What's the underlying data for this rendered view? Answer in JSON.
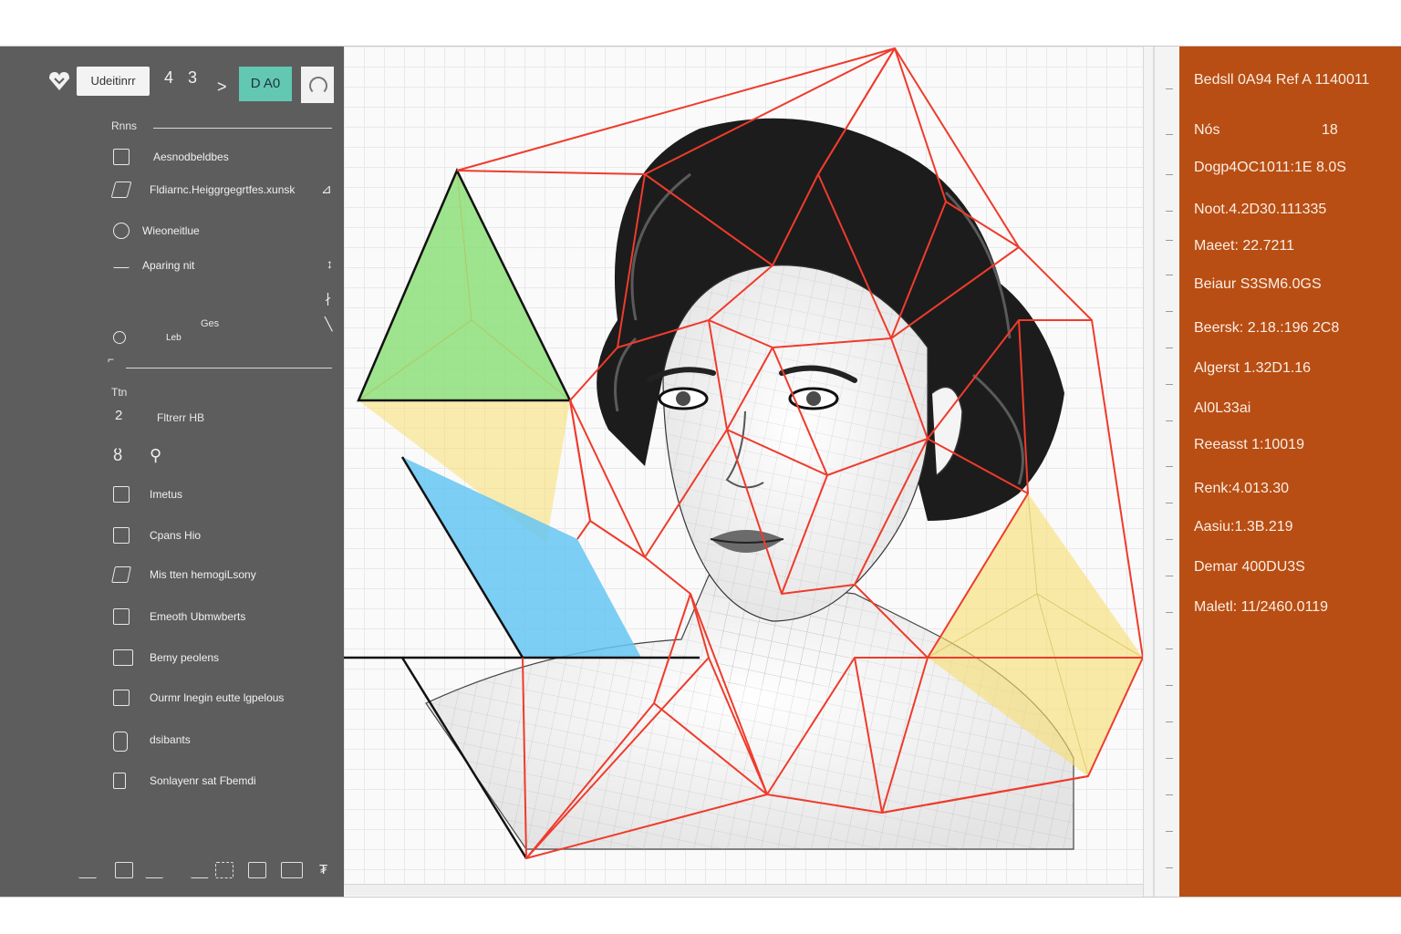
{
  "toolbar": {
    "search_label": "Udeitinrr",
    "glyph_a": "4",
    "glyph_b": "3",
    "chevron": ">",
    "teal_button_label": "D A0"
  },
  "sidebar": {
    "section1_label": "Rnns",
    "items_top": [
      {
        "label": "Aesnodbeldbes",
        "icon": "image-icon"
      },
      {
        "label": "Fldiarnc.Heiggrgegrtfes.xunsk",
        "icon": "brush-icon"
      },
      {
        "label": "Wieoneitlue",
        "icon": "layers-icon"
      },
      {
        "label": "Aparing nit",
        "icon": "wave-icon"
      },
      {
        "label": "Ges",
        "icon": "none"
      },
      {
        "label": "Leb",
        "icon": "pin-icon"
      }
    ],
    "section2_label": "Ttn",
    "section2_item": "Fltrerr HB",
    "section2_num": "2",
    "items_bottom": [
      {
        "label": "Imetus",
        "icon": "image-icon"
      },
      {
        "label": "Cpans Hio",
        "icon": "square-icon"
      },
      {
        "label": "Mis tten hemogiLsony",
        "icon": "pen-icon"
      },
      {
        "label": "Emeoth Ubmwberts",
        "icon": "frame-icon"
      },
      {
        "label": "Bemy peolens",
        "icon": "stack-icon"
      },
      {
        "label": "Ourmr lnegin eutte lgpelous",
        "icon": "grid-icon"
      },
      {
        "label": "dsibants",
        "icon": "phone-icon"
      },
      {
        "label": "Sonlayenr sat Fbemdi",
        "icon": "bracket-icon"
      }
    ]
  },
  "properties": [
    {
      "label": "Bedsll 0A94 Ref A 1140011",
      "value": ""
    },
    {
      "label": "Nós",
      "value": "18"
    },
    {
      "label": "Dogp4OC1011:1E 8.0S",
      "value": ""
    },
    {
      "label": "Noot.4.2D30.111335",
      "value": ""
    },
    {
      "label": "Maeet: 22.7211",
      "value": ""
    },
    {
      "label": "Beiaur S3SM6.0GS",
      "value": ""
    },
    {
      "label": "Beersk: 2.18.:196 2C8",
      "value": ""
    },
    {
      "label": "Algerst 1.32D1.16",
      "value": ""
    },
    {
      "label": "Al0L33ai",
      "value": ""
    },
    {
      "label": "Reeasst 1:10019",
      "value": ""
    },
    {
      "label": "Renk:4.013.30",
      "value": ""
    },
    {
      "label": "Aasiu:1.3B.219",
      "value": ""
    },
    {
      "label": "Demar 400DU3S",
      "value": ""
    },
    {
      "label": "Maletl: 11/2460.0119",
      "value": ""
    }
  ],
  "colors": {
    "sidebar_bg": "#5d5d5d",
    "panel_bg": "#b84e14",
    "accent_teal": "#62c8b2",
    "mesh_red": "#ef3b2c",
    "poly_green": "#8fe07a",
    "poly_yellow": "#f7de6e",
    "poly_blue": "#66c6f3"
  }
}
